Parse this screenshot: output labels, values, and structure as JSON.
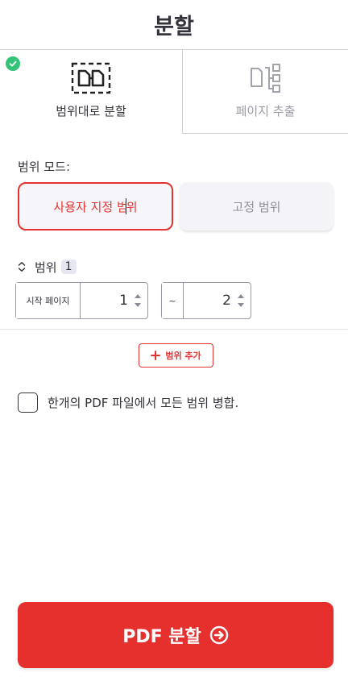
{
  "header": {
    "title": "분할"
  },
  "tabs": [
    {
      "label": "범위대로 분할",
      "icon": "split-range-icon",
      "selected": true
    },
    {
      "label": "페이지 추출",
      "icon": "extract-pages-icon",
      "selected": false
    }
  ],
  "mode": {
    "label": "범위 모드:",
    "options": [
      {
        "label_part1": "사용자 지정 범",
        "label_part2": "위",
        "selected": true
      },
      {
        "label": "고정 범위",
        "selected": false
      }
    ]
  },
  "range": {
    "label": "범위",
    "number": "1",
    "from": {
      "prefix": "시작 페이지",
      "value": "1"
    },
    "to": {
      "prefix": "~",
      "value": "2"
    }
  },
  "add_range": {
    "label": "범위 추가"
  },
  "merge": {
    "label": "한개의 PDF 파일에서 모든 범위 병합.",
    "checked": false
  },
  "submit": {
    "label": "PDF 분할"
  },
  "colors": {
    "accent": "#e3322f",
    "success": "#33c47a",
    "text": "#33333b",
    "muted": "#9a9aa5"
  }
}
